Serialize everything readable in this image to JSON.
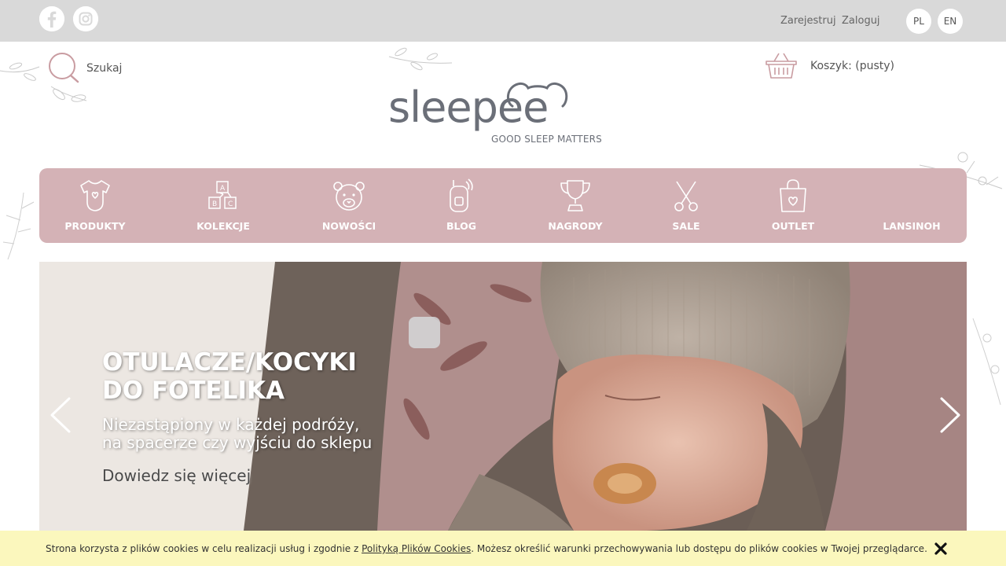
{
  "topbar": {
    "social": [
      {
        "icon": "facebook-icon"
      },
      {
        "icon": "instagram-icon"
      }
    ],
    "register_label": "Zarejestruj",
    "login_label": "Zaloguj",
    "languages": [
      "PL",
      "EN"
    ]
  },
  "search": {
    "label": "Szukaj",
    "icon": "search-icon"
  },
  "cart": {
    "label": "Koszyk: (pusty)",
    "icon": "basket-icon"
  },
  "logo": {
    "word": "sleepee",
    "tagline": "GOOD SLEEP MATTERS"
  },
  "nav": {
    "items": [
      {
        "label": "PRODUKTY",
        "icon": "baby-bodysuit-icon"
      },
      {
        "label": "KOLEKCJE",
        "icon": "abc-blocks-icon"
      },
      {
        "label": "NOWOŚCI",
        "icon": "teddy-bear-icon"
      },
      {
        "label": "BLOG",
        "icon": "baby-monitor-icon"
      },
      {
        "label": "NAGRODY",
        "icon": "trophy-icon"
      },
      {
        "label": "SALE",
        "icon": "scissors-icon"
      },
      {
        "label": "OUTLET",
        "icon": "shopping-bag-icon"
      },
      {
        "label": "LANSINOH",
        "icon": ""
      }
    ]
  },
  "hero": {
    "title_line1": "OTULACZE/KOCYKI",
    "title_line2": "DO FOTELIKA",
    "subtitle_line1": "Niezastąpiony w każdej podróży,",
    "subtitle_line2": "na spacerze czy wyjściu do sklepu",
    "cta": "Dowiedz się więcej"
  },
  "cookie": {
    "text_before": "Strona korzysta z plików cookies w celu realizacji usług i zgodnie z ",
    "link": "Polityką Plików Cookies",
    "text_after": ". Możesz określić warunki przechowywania lub dostępu do plików cookies w Twojej przeglądarce."
  },
  "colors": {
    "topbar": "#d9d9d9",
    "nav_bg": "#d4b2b6",
    "accent_pink": "#c9a0a4",
    "logo_gray": "#6b6f78",
    "cookie_bg": "#fbf7bd"
  }
}
